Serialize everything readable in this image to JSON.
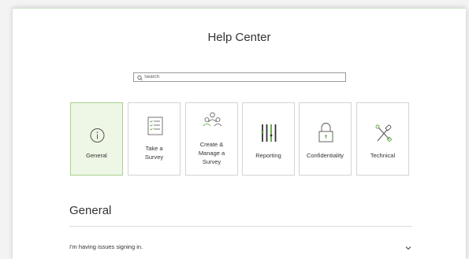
{
  "page": {
    "title": "Help Center"
  },
  "search": {
    "placeholder": "Search"
  },
  "categories": [
    {
      "label": "General",
      "icon": "info-circle-icon"
    },
    {
      "label": "Take a Survey",
      "icon": "checklist-icon"
    },
    {
      "label": "Create & Manage a Survey",
      "icon": "people-group-icon"
    },
    {
      "label": "Reporting",
      "icon": "bar-lines-icon"
    },
    {
      "label": "Confidentiality",
      "icon": "padlock-icon"
    },
    {
      "label": "Technical",
      "icon": "tools-icon"
    }
  ],
  "active_category": "General",
  "section": {
    "heading": "General"
  },
  "faq": [
    {
      "question": "I'm having issues signing in."
    }
  ],
  "colors": {
    "accent": "#5aa53a",
    "active_tile_bg": "#eef7e6",
    "active_tile_border": "#a9d18c",
    "tile_border": "#d4d4d4",
    "text": "#333333"
  }
}
